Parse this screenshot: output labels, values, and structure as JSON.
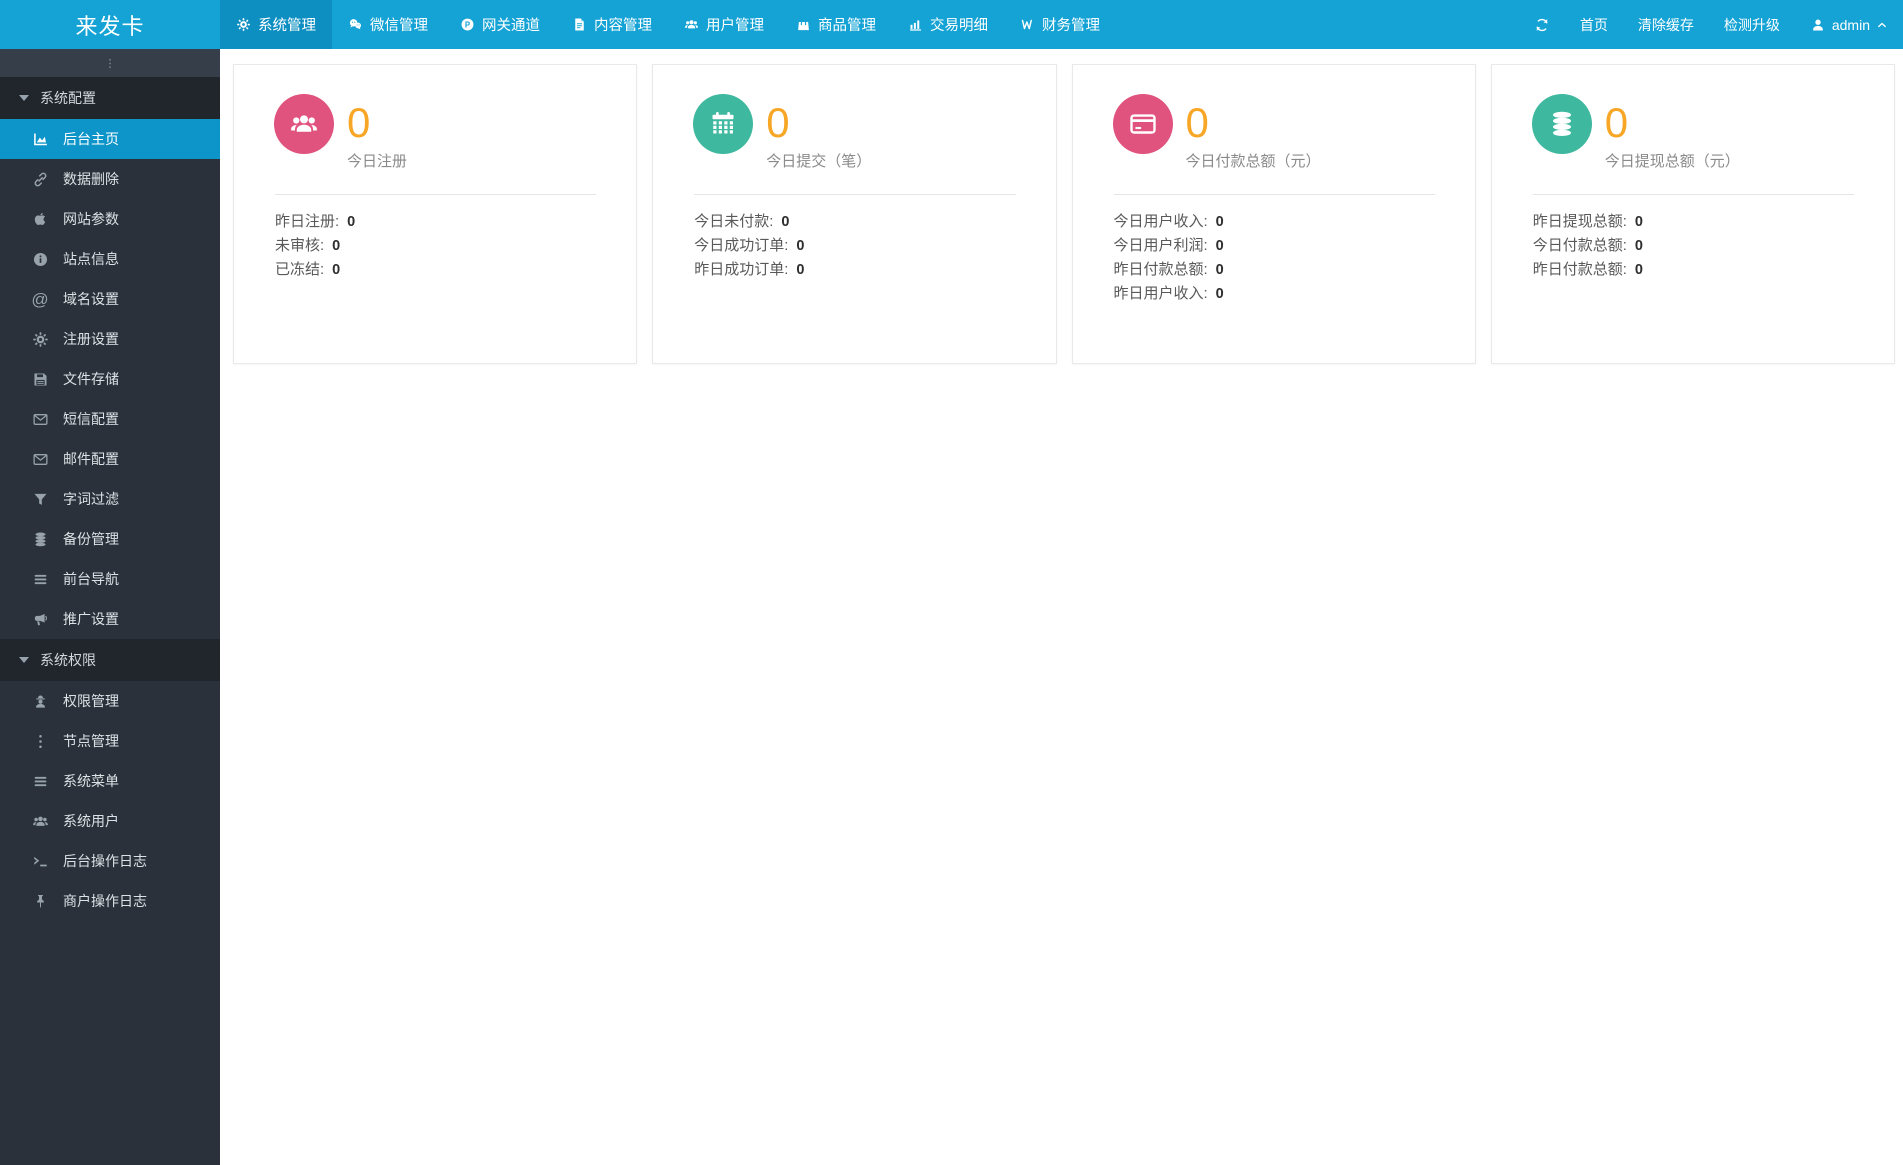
{
  "topbar": {
    "logo": "来发卡",
    "nav": [
      {
        "id": "system-management",
        "label": "系统管理",
        "icon": "gear-icon",
        "active": true
      },
      {
        "id": "wechat-management",
        "label": "微信管理",
        "icon": "wechat-icon",
        "active": false
      },
      {
        "id": "gateway-channel",
        "label": "网关通道",
        "icon": "gateway-p-icon",
        "active": false
      },
      {
        "id": "content-management",
        "label": "内容管理",
        "icon": "document-icon",
        "active": false
      },
      {
        "id": "user-management",
        "label": "用户管理",
        "icon": "users-icon",
        "active": false
      },
      {
        "id": "goods-management",
        "label": "商品管理",
        "icon": "shopping-bag-icon",
        "active": false
      },
      {
        "id": "transaction-detail",
        "label": "交易明细",
        "icon": "bar-chart-icon",
        "active": false
      },
      {
        "id": "finance-management",
        "label": "财务管理",
        "icon": "finance-icon",
        "active": false
      }
    ],
    "actions": [
      {
        "id": "refresh",
        "label": "",
        "icon": "refresh-icon"
      },
      {
        "id": "home",
        "label": "首页"
      },
      {
        "id": "clear-cache",
        "label": "清除缓存"
      },
      {
        "id": "check-upgrade",
        "label": "检测升级"
      }
    ],
    "user": {
      "name": "admin",
      "icon": "user-icon",
      "chevron": "chevron-up-icon"
    }
  },
  "sidebar": {
    "toggle_icon": "ellipsis-v-icon",
    "sections": [
      {
        "id": "system-config",
        "title": "系统配置",
        "items": [
          {
            "id": "dashboard",
            "label": "后台主页",
            "icon": "chart-area-icon",
            "active": true
          },
          {
            "id": "data-delete",
            "label": "数据删除",
            "icon": "link-icon",
            "active": false
          },
          {
            "id": "site-params",
            "label": "网站参数",
            "icon": "apple-icon",
            "active": false
          },
          {
            "id": "site-info",
            "label": "站点信息",
            "icon": "info-icon",
            "active": false
          },
          {
            "id": "domain-settings",
            "label": "域名设置",
            "icon": "at-icon",
            "active": false
          },
          {
            "id": "register-settings",
            "label": "注册设置",
            "icon": "gear-icon",
            "active": false
          },
          {
            "id": "file-storage",
            "label": "文件存储",
            "icon": "floppy-icon",
            "active": false
          },
          {
            "id": "sms-config",
            "label": "短信配置",
            "icon": "envelope-icon",
            "active": false
          },
          {
            "id": "mail-config",
            "label": "邮件配置",
            "icon": "envelope-icon",
            "active": false
          },
          {
            "id": "word-filter",
            "label": "字词过滤",
            "icon": "filter-icon",
            "active": false
          },
          {
            "id": "backup-management",
            "label": "备份管理",
            "icon": "database-icon",
            "active": false
          },
          {
            "id": "front-nav",
            "label": "前台导航",
            "icon": "bars-icon",
            "active": false
          },
          {
            "id": "promotion-settings",
            "label": "推广设置",
            "icon": "bullhorn-icon",
            "active": false
          }
        ]
      },
      {
        "id": "system-permission",
        "title": "系统权限",
        "items": [
          {
            "id": "permission-management",
            "label": "权限管理",
            "icon": "user-secret-icon",
            "active": false
          },
          {
            "id": "node-management",
            "label": "节点管理",
            "icon": "ellipsis-v-icon",
            "active": false
          },
          {
            "id": "system-menu",
            "label": "系统菜单",
            "icon": "bars-icon",
            "active": false
          },
          {
            "id": "system-users",
            "label": "系统用户",
            "icon": "users-icon",
            "active": false
          },
          {
            "id": "admin-op-log",
            "label": "后台操作日志",
            "icon": "terminal-icon",
            "active": false
          },
          {
            "id": "merchant-op-log",
            "label": "商户操作日志",
            "icon": "thumbtack-icon",
            "active": false
          }
        ]
      }
    ]
  },
  "cards": [
    {
      "id": "today-register",
      "icon": "users-icon",
      "circle_color": "#e0537f",
      "value": "0",
      "label": "今日注册",
      "rows": [
        {
          "label": "昨日注册:",
          "value": "0"
        },
        {
          "label": "未审核:",
          "value": "0"
        },
        {
          "label": "已冻结:",
          "value": "0"
        }
      ]
    },
    {
      "id": "today-submit",
      "icon": "calendar-icon",
      "circle_color": "#3eb89e",
      "value": "0",
      "label": "今日提交（笔）",
      "rows": [
        {
          "label": "今日未付款:",
          "value": "0"
        },
        {
          "label": "今日成功订单:",
          "value": "0"
        },
        {
          "label": "昨日成功订单:",
          "value": "0"
        }
      ]
    },
    {
      "id": "today-payment-total",
      "icon": "credit-card-icon",
      "circle_color": "#e0537f",
      "value": "0",
      "label": "今日付款总额（元）",
      "rows": [
        {
          "label": "今日用户收入:",
          "value": "0"
        },
        {
          "label": "今日用户利润:",
          "value": "0"
        },
        {
          "label": "昨日付款总额:",
          "value": "0"
        },
        {
          "label": "昨日用户收入:",
          "value": "0"
        }
      ]
    },
    {
      "id": "today-withdraw-total",
      "icon": "database-icon",
      "circle_color": "#3eb89e",
      "value": "0",
      "label": "今日提现总额（元）",
      "rows": [
        {
          "label": "昨日提现总额:",
          "value": "0"
        },
        {
          "label": "今日付款总额:",
          "value": "0"
        },
        {
          "label": "昨日付款总额:",
          "value": "0"
        }
      ]
    }
  ],
  "colors": {
    "topbar_bg": "#15a3d5",
    "topbar_active_bg": "#0e8fc2",
    "sidebar_bg": "#2a313a",
    "sidebar_section_bg": "#21262c",
    "sidebar_toggle_bg": "#363f49",
    "sidebar_active_bg": "#0d95c9",
    "card_value_color": "#f7a626",
    "pink": "#e0537f",
    "teal": "#3eb89e"
  }
}
